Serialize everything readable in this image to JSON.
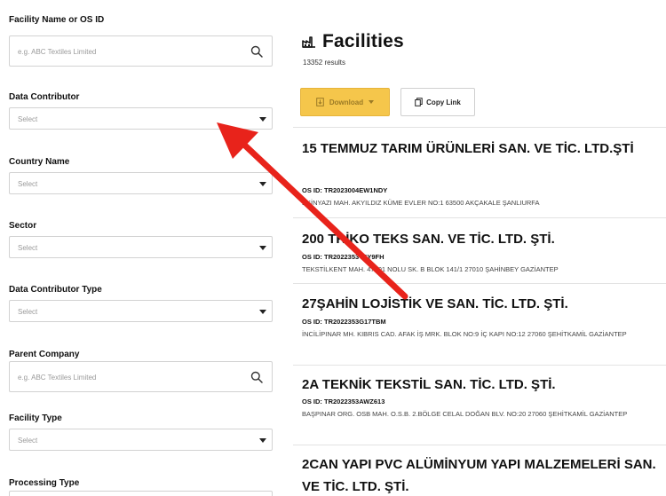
{
  "filters": {
    "facility_name": {
      "label": "Facility Name or OS ID",
      "placeholder": "e.g. ABC Textiles Limited"
    },
    "data_contributor": {
      "label": "Data Contributor",
      "placeholder": "Select"
    },
    "country_name": {
      "label": "Country Name",
      "placeholder": "Select"
    },
    "sector": {
      "label": "Sector",
      "placeholder": "Select"
    },
    "data_contributor_type": {
      "label": "Data Contributor Type",
      "placeholder": "Select"
    },
    "parent_company": {
      "label": "Parent Company",
      "placeholder": "e.g. ABC Textiles Limited"
    },
    "facility_type": {
      "label": "Facility Type",
      "placeholder": "Select"
    },
    "processing_type": {
      "label": "Processing Type"
    }
  },
  "results": {
    "title": "Facilities",
    "count": "13352 results",
    "download_label": "Download",
    "copy_link_label": "Copy Link",
    "items": [
      {
        "name": "15 TEMMUZ TARIM ÜRÜNLERİ SAN. VE TİC. LTD.ŞTİ",
        "os_id": "OS ID: TR2023004EW1NDY",
        "address": "EKİNYAZI MAH. AKYILDIZ KÜME EVLER NO:1  63500   AKÇAKALE ŞANLIURFA"
      },
      {
        "name": "200 TRİKO TEKS SAN. VE TİC. LTD. ŞTİ.",
        "os_id": "OS ID: TR2022353Y6Y9FH",
        "address": "TEKSTİLKENT MAH. 47001 NOLU SK. B BLOK 141/1  27010   ŞAHİNBEY GAZİANTEP"
      },
      {
        "name": "27ŞAHİN LOJİSTİK VE SAN. TİC. LTD. ŞTİ.",
        "os_id": "OS ID: TR2022353G17TBM",
        "address": "İNCİLİPINAR MH. KIBRIS CAD. AFAK İŞ MRK. BLOK NO:9 İÇ KAPI NO:12 27060   ŞEHİTKAMİL GAZİANTEP"
      },
      {
        "name": "2A TEKNİK TEKSTİL SAN. TİC. LTD. ŞTİ.",
        "os_id": "OS ID: TR2022353AWZ613",
        "address": "BAŞPINAR ORG. OSB MAH. O.S.B. 2.BÖLGE CELAL DOĞAN  BLV. NO:20 27060   ŞEHİTKAMİL GAZİANTEP"
      },
      {
        "name": "2CAN YAPI PVC ALÜMİNYUM YAPI MALZEMELERİ SAN. VE TİC. LTD. ŞTİ."
      }
    ]
  },
  "colors": {
    "download_bg": "#f5c64b",
    "annotation_arrow": "#e8231b",
    "border": "#d2d2d2"
  },
  "icons": {
    "facilities_title": "factory-icon",
    "search": "search-icon",
    "copy": "copy-icon",
    "download": "download-icon"
  }
}
